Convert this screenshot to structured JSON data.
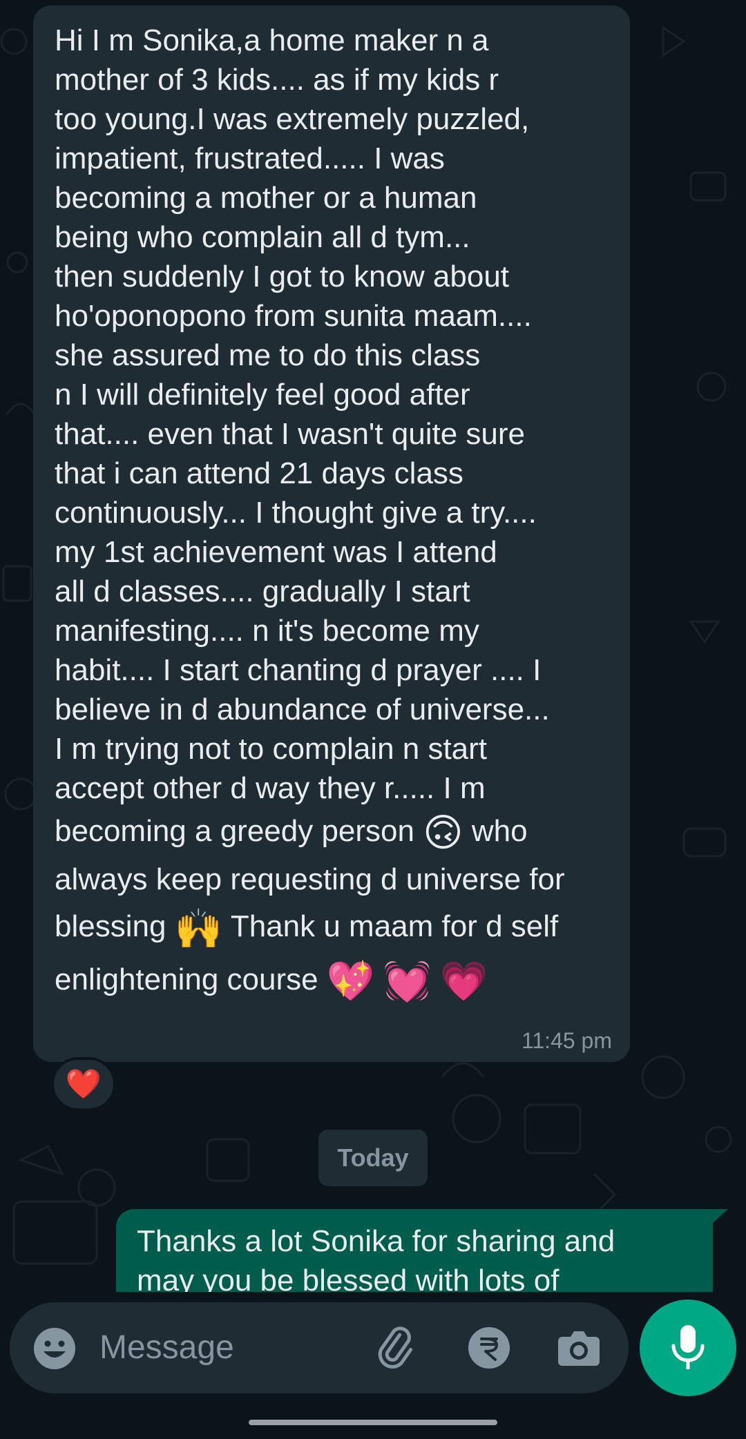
{
  "incoming_message": {
    "lines": [
      "Hi I m Sonika,a home maker  n a",
      "mother of 3 kids.... as if my kids r",
      "too young.I  was extremely puzzled,",
      "impatient, frustrated..... I was",
      "becoming a mother or a human",
      "being who complain all d tym...",
      "then suddenly I got to know about",
      "ho'oponopono from sunita maam....",
      "she assured me to do this class",
      "n I will definitely feel good after",
      "that.... even that I wasn't quite sure",
      "that i can attend  21 days class",
      "continuously... I thought give a try....",
      "my 1st achievement  was I attend",
      "all d classes....  gradually I start",
      "manifesting.... n  it's become my",
      "habit.... I start chanting d prayer .... I",
      "believe in d abundance of universe...",
      "I m trying not to  complain n start",
      "accept other d way they r..... I m"
    ],
    "line21_before": "becoming a greedy person ",
    "line21_emoji": "🙃",
    "line21_after": " who",
    "line22": "always keep requesting d universe for",
    "line23_before": "blessing ",
    "line23_emoji": "🙌",
    "line23_after": " Thank u maam for d self",
    "line24_before": "enlightening course ",
    "line24_emojis": [
      "💖",
      "💓",
      "💗"
    ],
    "time": "11:45 pm",
    "reaction": "❤️"
  },
  "date_divider": "Today",
  "outgoing_message": {
    "text_line1": "Thanks a lot Sonika for sharing and",
    "text_line2": "may you be blessed with lots of"
  },
  "composer": {
    "placeholder": "Message",
    "emoji_icon": "smiley-icon",
    "attach_icon": "paperclip-icon",
    "payment_icon": "rupee-icon",
    "camera_icon": "camera-icon",
    "mic_icon": "microphone-icon"
  },
  "colors": {
    "background": "#0b141a",
    "incoming_bubble": "#202c33",
    "outgoing_bubble": "#005c4b",
    "accent": "#00a884",
    "muted_text": "#8696a0"
  }
}
